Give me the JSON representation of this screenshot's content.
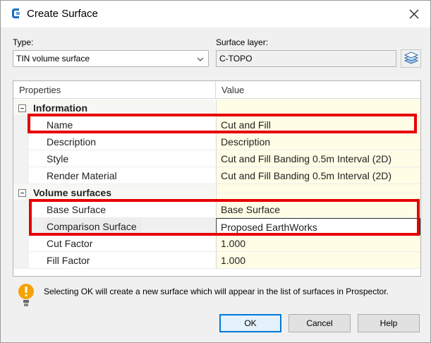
{
  "window": {
    "title": "Create Surface",
    "close_icon": "close-icon",
    "app_icon": "civil3d-app-icon"
  },
  "form": {
    "type_label": "Type:",
    "type_value": "TIN volume surface",
    "surface_layer_label": "Surface layer:",
    "surface_layer_value": "C-TOPO",
    "layer_button_icon": "layers-icon"
  },
  "grid": {
    "columns": [
      "Properties",
      "Value"
    ],
    "categories": [
      {
        "label": "Information",
        "rows": [
          {
            "name": "Name",
            "value": "Cut and Fill"
          },
          {
            "name": "Description",
            "value": "Description"
          },
          {
            "name": "Style",
            "value": "Cut and Fill Banding 0.5m Interval (2D)"
          },
          {
            "name": "Render Material",
            "value": "Cut and Fill Banding 0.5m Interval (2D)"
          }
        ]
      },
      {
        "label": "Volume surfaces",
        "rows": [
          {
            "name": "Base Surface",
            "value": "Base Surface"
          },
          {
            "name": "Comparison Surface",
            "value": "Proposed EarthWorks"
          },
          {
            "name": "Cut Factor",
            "value": "1.000"
          },
          {
            "name": "Fill Factor",
            "value": "1.000"
          }
        ]
      }
    ]
  },
  "info": {
    "icon": "warning-lightbulb-icon",
    "text": "Selecting OK will create a new surface which will appear in the list of surfaces in Prospector."
  },
  "buttons": {
    "ok": "OK",
    "cancel": "Cancel",
    "help": "Help"
  },
  "colors": {
    "highlight": "#e60000",
    "value_column_bg": "#fffde6",
    "accent": "#0078d7"
  }
}
